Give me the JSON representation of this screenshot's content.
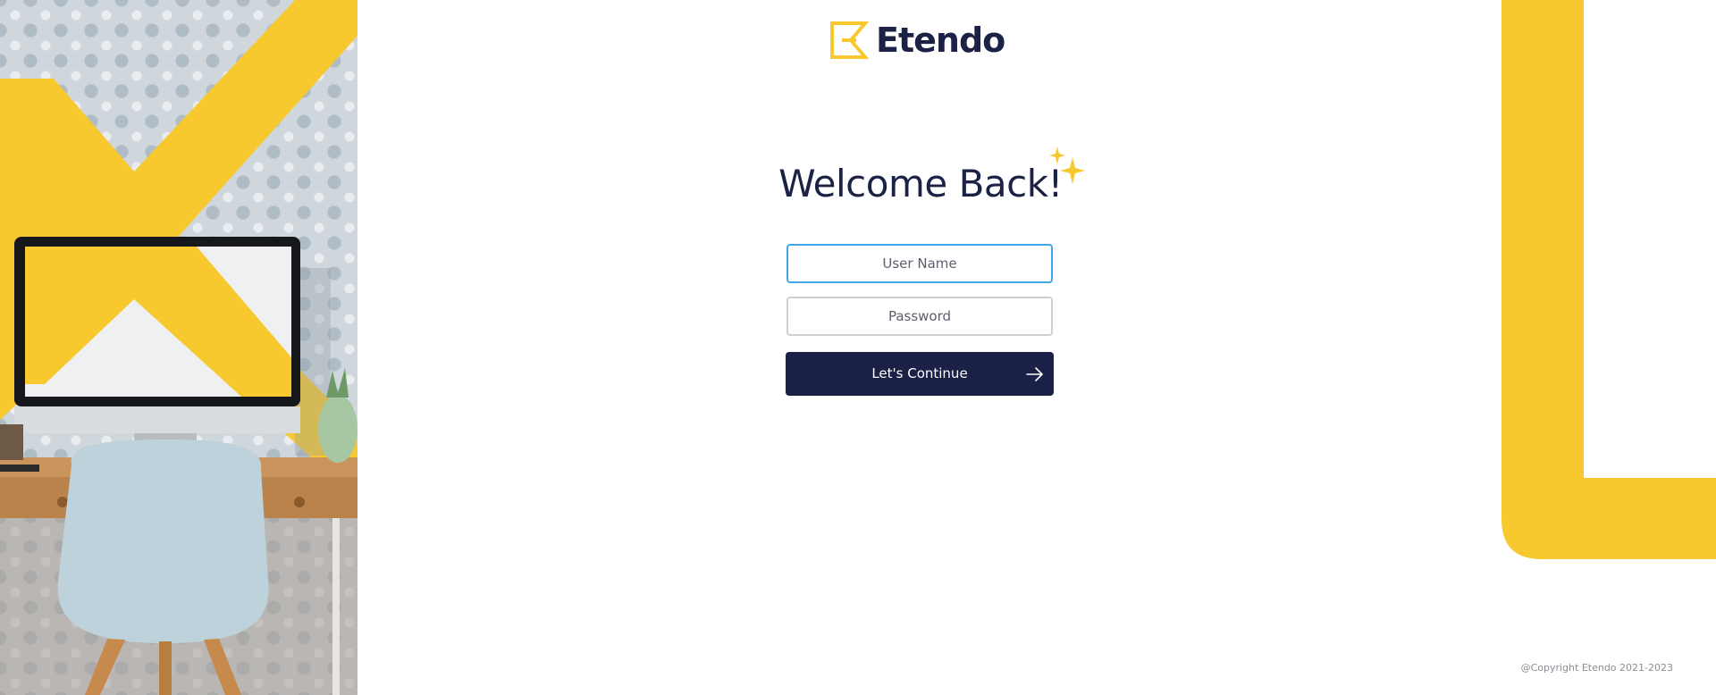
{
  "brand": {
    "name": "Etendo",
    "primary_color": "#1c2146",
    "accent_color": "#f8c92f",
    "logo_icon": "etendo-e-logo-icon"
  },
  "login": {
    "heading": "Welcome Back!",
    "heading_icon": "sparkles-icon",
    "username": {
      "placeholder": "User Name",
      "value": ""
    },
    "password": {
      "placeholder": "Password",
      "value": ""
    },
    "continue_button": {
      "label": "Let's Continue",
      "icon": "arrow-right-icon"
    }
  },
  "footer": {
    "copyright": "@Copyright Etendo 2021-2023"
  },
  "decor": {
    "left_image": "workspace-illustration",
    "right_shape": "yellow-l-shape"
  }
}
